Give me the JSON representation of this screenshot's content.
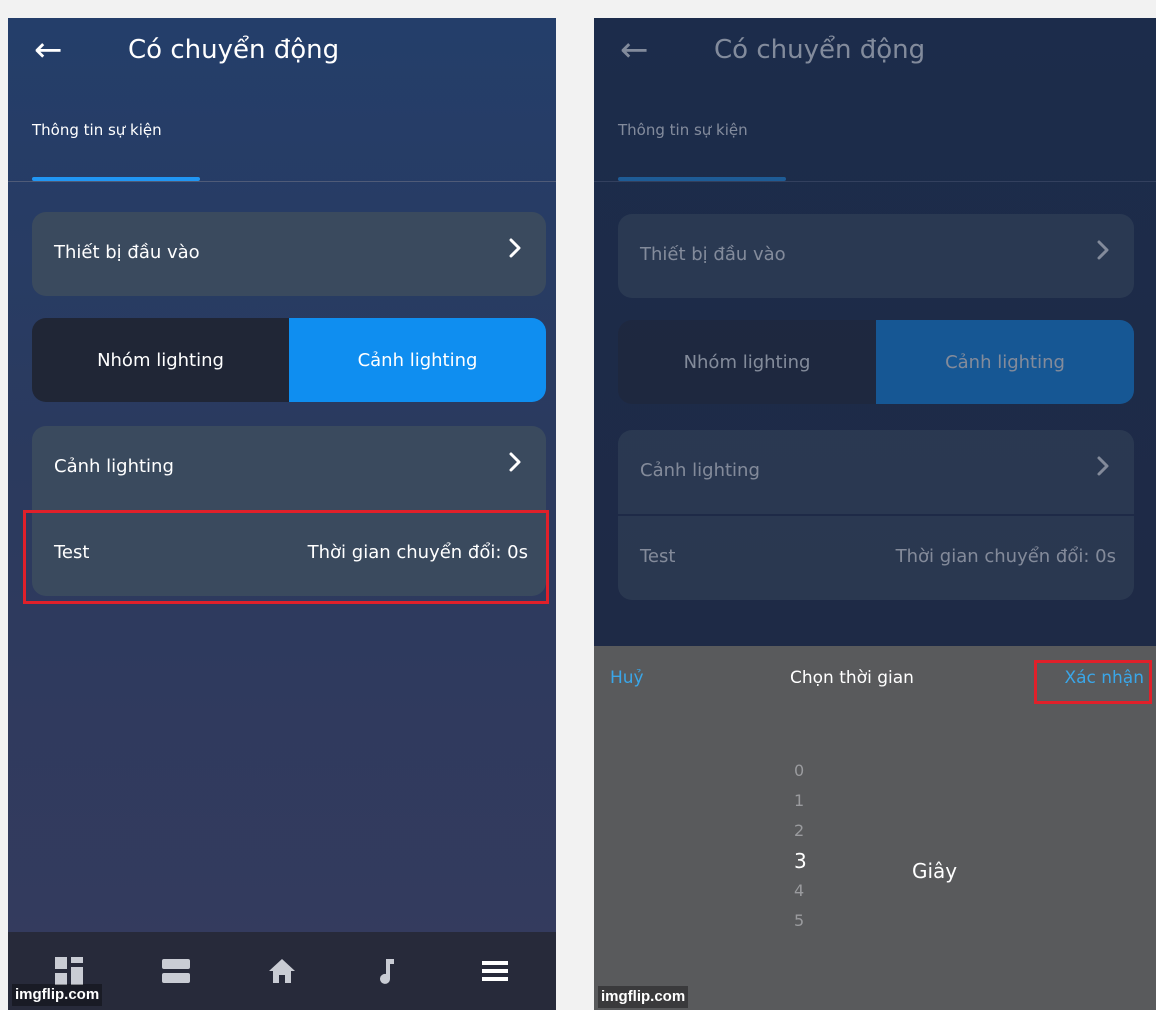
{
  "colors": {
    "accent": "#2196f3",
    "segment_active": "#0f8ef0",
    "highlight": "#e0202a",
    "link": "#3aa6e8"
  },
  "left": {
    "header": {
      "back_icon": "arrow-left-icon",
      "title": "Có chuyển động"
    },
    "tab": {
      "label": "Thông tin sự kiện"
    },
    "input_device": {
      "label": "Thiết bị đầu vào",
      "chevron": "›"
    },
    "segment": {
      "option_1": "Nhóm lighting",
      "option_2": "Cảnh lighting",
      "selected": "Cảnh lighting"
    },
    "scene": {
      "label": "Cảnh lighting",
      "chevron": "›"
    },
    "test_row": {
      "label": "Test",
      "value": "Thời gian chuyển đổi: 0s"
    },
    "bottom_nav": [
      "dashboard-icon",
      "rows-icon",
      "home-icon",
      "music-note-icon",
      "menu-icon"
    ],
    "watermark": "imgflip.com"
  },
  "right": {
    "header": {
      "back_icon": "arrow-left-icon",
      "title": "Có chuyển động"
    },
    "tab": {
      "label": "Thông tin sự kiện"
    },
    "input_device": {
      "label": "Thiết bị đầu vào",
      "chevron": "›"
    },
    "segment": {
      "option_1": "Nhóm lighting",
      "option_2": "Cảnh lighting"
    },
    "scene": {
      "label": "Cảnh lighting",
      "chevron": "›"
    },
    "test_row": {
      "label": "Test",
      "value": "Thời gian chuyển đổi: 0s"
    },
    "sheet": {
      "cancel": "Huỷ",
      "title": "Chọn thời gian",
      "confirm": "Xác nhận",
      "options": [
        "0",
        "1",
        "2",
        "3",
        "4",
        "5"
      ],
      "selected": "3",
      "unit": "Giây"
    },
    "watermark": "imgflip.com"
  }
}
